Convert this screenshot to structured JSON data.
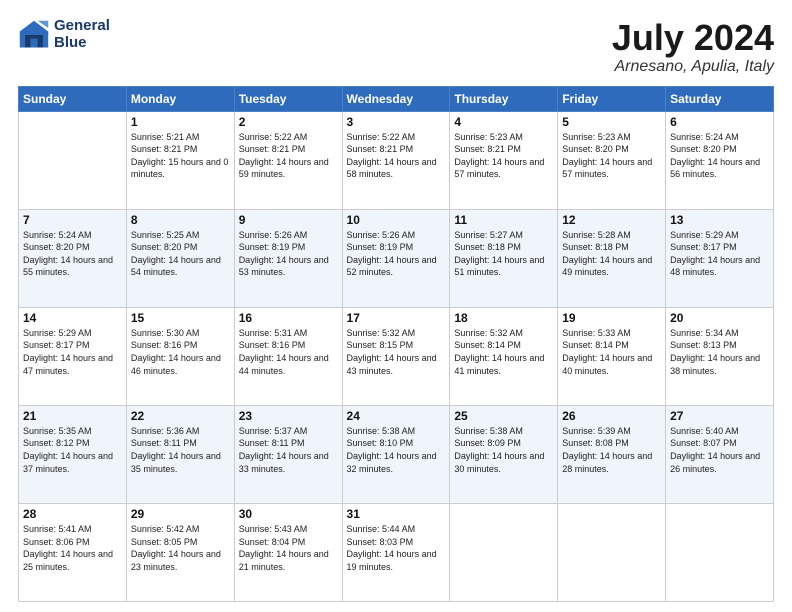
{
  "header": {
    "logo_line1": "General",
    "logo_line2": "Blue",
    "month": "July 2024",
    "location": "Arnesano, Apulia, Italy"
  },
  "weekdays": [
    "Sunday",
    "Monday",
    "Tuesday",
    "Wednesday",
    "Thursday",
    "Friday",
    "Saturday"
  ],
  "weeks": [
    [
      {
        "day": "",
        "sunrise": "",
        "sunset": "",
        "daylight": ""
      },
      {
        "day": "1",
        "sunrise": "Sunrise: 5:21 AM",
        "sunset": "Sunset: 8:21 PM",
        "daylight": "Daylight: 15 hours and 0 minutes."
      },
      {
        "day": "2",
        "sunrise": "Sunrise: 5:22 AM",
        "sunset": "Sunset: 8:21 PM",
        "daylight": "Daylight: 14 hours and 59 minutes."
      },
      {
        "day": "3",
        "sunrise": "Sunrise: 5:22 AM",
        "sunset": "Sunset: 8:21 PM",
        "daylight": "Daylight: 14 hours and 58 minutes."
      },
      {
        "day": "4",
        "sunrise": "Sunrise: 5:23 AM",
        "sunset": "Sunset: 8:21 PM",
        "daylight": "Daylight: 14 hours and 57 minutes."
      },
      {
        "day": "5",
        "sunrise": "Sunrise: 5:23 AM",
        "sunset": "Sunset: 8:20 PM",
        "daylight": "Daylight: 14 hours and 57 minutes."
      },
      {
        "day": "6",
        "sunrise": "Sunrise: 5:24 AM",
        "sunset": "Sunset: 8:20 PM",
        "daylight": "Daylight: 14 hours and 56 minutes."
      }
    ],
    [
      {
        "day": "7",
        "sunrise": "Sunrise: 5:24 AM",
        "sunset": "Sunset: 8:20 PM",
        "daylight": "Daylight: 14 hours and 55 minutes."
      },
      {
        "day": "8",
        "sunrise": "Sunrise: 5:25 AM",
        "sunset": "Sunset: 8:20 PM",
        "daylight": "Daylight: 14 hours and 54 minutes."
      },
      {
        "day": "9",
        "sunrise": "Sunrise: 5:26 AM",
        "sunset": "Sunset: 8:19 PM",
        "daylight": "Daylight: 14 hours and 53 minutes."
      },
      {
        "day": "10",
        "sunrise": "Sunrise: 5:26 AM",
        "sunset": "Sunset: 8:19 PM",
        "daylight": "Daylight: 14 hours and 52 minutes."
      },
      {
        "day": "11",
        "sunrise": "Sunrise: 5:27 AM",
        "sunset": "Sunset: 8:18 PM",
        "daylight": "Daylight: 14 hours and 51 minutes."
      },
      {
        "day": "12",
        "sunrise": "Sunrise: 5:28 AM",
        "sunset": "Sunset: 8:18 PM",
        "daylight": "Daylight: 14 hours and 49 minutes."
      },
      {
        "day": "13",
        "sunrise": "Sunrise: 5:29 AM",
        "sunset": "Sunset: 8:17 PM",
        "daylight": "Daylight: 14 hours and 48 minutes."
      }
    ],
    [
      {
        "day": "14",
        "sunrise": "Sunrise: 5:29 AM",
        "sunset": "Sunset: 8:17 PM",
        "daylight": "Daylight: 14 hours and 47 minutes."
      },
      {
        "day": "15",
        "sunrise": "Sunrise: 5:30 AM",
        "sunset": "Sunset: 8:16 PM",
        "daylight": "Daylight: 14 hours and 46 minutes."
      },
      {
        "day": "16",
        "sunrise": "Sunrise: 5:31 AM",
        "sunset": "Sunset: 8:16 PM",
        "daylight": "Daylight: 14 hours and 44 minutes."
      },
      {
        "day": "17",
        "sunrise": "Sunrise: 5:32 AM",
        "sunset": "Sunset: 8:15 PM",
        "daylight": "Daylight: 14 hours and 43 minutes."
      },
      {
        "day": "18",
        "sunrise": "Sunrise: 5:32 AM",
        "sunset": "Sunset: 8:14 PM",
        "daylight": "Daylight: 14 hours and 41 minutes."
      },
      {
        "day": "19",
        "sunrise": "Sunrise: 5:33 AM",
        "sunset": "Sunset: 8:14 PM",
        "daylight": "Daylight: 14 hours and 40 minutes."
      },
      {
        "day": "20",
        "sunrise": "Sunrise: 5:34 AM",
        "sunset": "Sunset: 8:13 PM",
        "daylight": "Daylight: 14 hours and 38 minutes."
      }
    ],
    [
      {
        "day": "21",
        "sunrise": "Sunrise: 5:35 AM",
        "sunset": "Sunset: 8:12 PM",
        "daylight": "Daylight: 14 hours and 37 minutes."
      },
      {
        "day": "22",
        "sunrise": "Sunrise: 5:36 AM",
        "sunset": "Sunset: 8:11 PM",
        "daylight": "Daylight: 14 hours and 35 minutes."
      },
      {
        "day": "23",
        "sunrise": "Sunrise: 5:37 AM",
        "sunset": "Sunset: 8:11 PM",
        "daylight": "Daylight: 14 hours and 33 minutes."
      },
      {
        "day": "24",
        "sunrise": "Sunrise: 5:38 AM",
        "sunset": "Sunset: 8:10 PM",
        "daylight": "Daylight: 14 hours and 32 minutes."
      },
      {
        "day": "25",
        "sunrise": "Sunrise: 5:38 AM",
        "sunset": "Sunset: 8:09 PM",
        "daylight": "Daylight: 14 hours and 30 minutes."
      },
      {
        "day": "26",
        "sunrise": "Sunrise: 5:39 AM",
        "sunset": "Sunset: 8:08 PM",
        "daylight": "Daylight: 14 hours and 28 minutes."
      },
      {
        "day": "27",
        "sunrise": "Sunrise: 5:40 AM",
        "sunset": "Sunset: 8:07 PM",
        "daylight": "Daylight: 14 hours and 26 minutes."
      }
    ],
    [
      {
        "day": "28",
        "sunrise": "Sunrise: 5:41 AM",
        "sunset": "Sunset: 8:06 PM",
        "daylight": "Daylight: 14 hours and 25 minutes."
      },
      {
        "day": "29",
        "sunrise": "Sunrise: 5:42 AM",
        "sunset": "Sunset: 8:05 PM",
        "daylight": "Daylight: 14 hours and 23 minutes."
      },
      {
        "day": "30",
        "sunrise": "Sunrise: 5:43 AM",
        "sunset": "Sunset: 8:04 PM",
        "daylight": "Daylight: 14 hours and 21 minutes."
      },
      {
        "day": "31",
        "sunrise": "Sunrise: 5:44 AM",
        "sunset": "Sunset: 8:03 PM",
        "daylight": "Daylight: 14 hours and 19 minutes."
      },
      {
        "day": "",
        "sunrise": "",
        "sunset": "",
        "daylight": ""
      },
      {
        "day": "",
        "sunrise": "",
        "sunset": "",
        "daylight": ""
      },
      {
        "day": "",
        "sunrise": "",
        "sunset": "",
        "daylight": ""
      }
    ]
  ]
}
